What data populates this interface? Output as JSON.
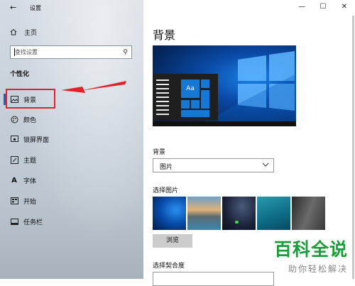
{
  "window": {
    "title": "设置",
    "controls": [
      "—",
      "☐",
      "✕"
    ]
  },
  "sidebar": {
    "home_label": "主页",
    "search_placeholder": "查找设置",
    "section_title": "个性化",
    "items": [
      {
        "label": "背景",
        "icon": "picture-icon",
        "selected": true
      },
      {
        "label": "颜色",
        "icon": "palette-icon"
      },
      {
        "label": "锁屏界面",
        "icon": "lock-screen-icon"
      },
      {
        "label": "主题",
        "icon": "brush-icon"
      },
      {
        "label": "字体",
        "icon": "font-icon"
      },
      {
        "label": "开始",
        "icon": "start-icon"
      },
      {
        "label": "任务栏",
        "icon": "taskbar-icon"
      }
    ]
  },
  "main": {
    "title": "背景",
    "preview_tile_label": "Aa",
    "background_label": "背景",
    "background_value": "图片",
    "choose_picture_label": "选择图片",
    "browse_label": "浏览",
    "choose_fit_label": "选择契合度"
  },
  "watermark": {
    "main": "百科全说",
    "sub": "助你轻松解决"
  },
  "colors": {
    "accent": "#0a6ad6",
    "highlight_box": "#e4212b",
    "watermark": "#1a9c3a"
  }
}
